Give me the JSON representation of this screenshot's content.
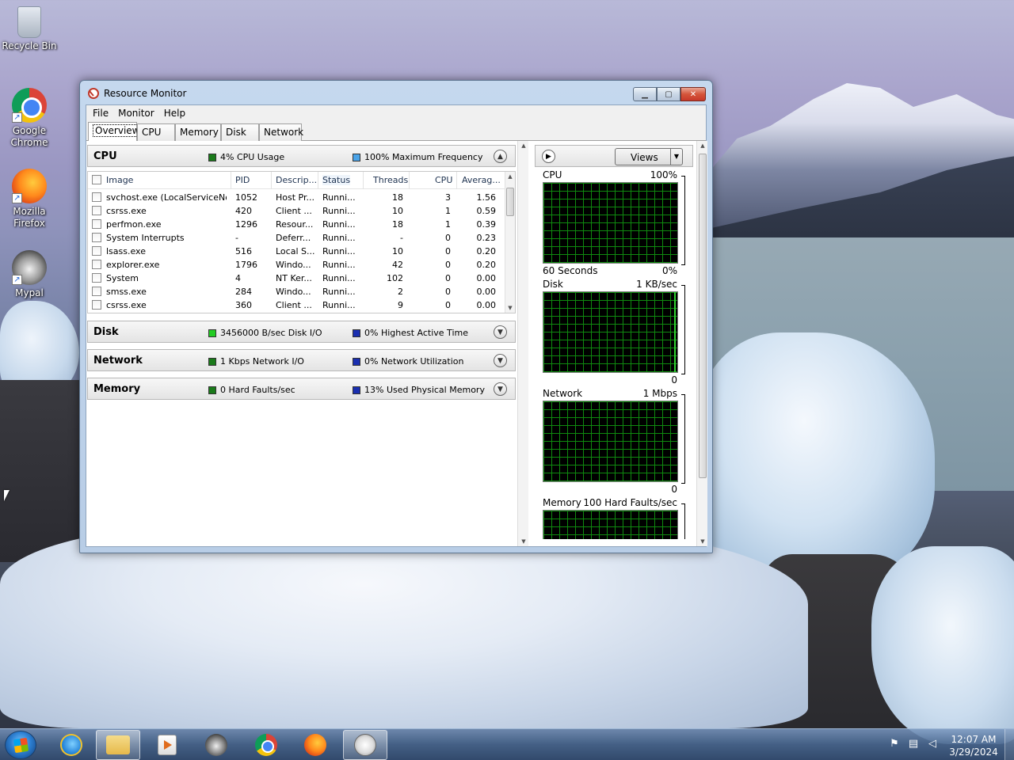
{
  "desktop": {
    "icons": [
      {
        "label": "Recycle Bin"
      },
      {
        "label": "Google\nChrome"
      },
      {
        "label": "Mozilla\nFirefox"
      },
      {
        "label": "Mypal"
      }
    ]
  },
  "window": {
    "title": "Resource Monitor",
    "menu": [
      "File",
      "Monitor",
      "Help"
    ],
    "tabs": [
      "Overview",
      "CPU",
      "Memory",
      "Disk",
      "Network"
    ],
    "active_tab": "Overview"
  },
  "cpu_section": {
    "title": "CPU",
    "legend1": "4% CPU Usage",
    "legend1_color": "#1a7a1a",
    "legend2": "100% Maximum Frequency",
    "legend2_color": "#4aa3e8",
    "columns": [
      "Image",
      "PID",
      "Descrip...",
      "Status",
      "Threads",
      "CPU",
      "Averag..."
    ],
    "rows": [
      {
        "image": "svchost.exe (LocalServiceNo...",
        "pid": "1052",
        "desc": "Host Pr...",
        "status": "Runni...",
        "threads": "18",
        "cpu": "3",
        "avg": "1.56"
      },
      {
        "image": "csrss.exe",
        "pid": "420",
        "desc": "Client ...",
        "status": "Runni...",
        "threads": "10",
        "cpu": "1",
        "avg": "0.59"
      },
      {
        "image": "perfmon.exe",
        "pid": "1296",
        "desc": "Resour...",
        "status": "Runni...",
        "threads": "18",
        "cpu": "1",
        "avg": "0.39"
      },
      {
        "image": "System Interrupts",
        "pid": "-",
        "desc": "Deferr...",
        "status": "Runni...",
        "threads": "-",
        "cpu": "0",
        "avg": "0.23"
      },
      {
        "image": "lsass.exe",
        "pid": "516",
        "desc": "Local S...",
        "status": "Runni...",
        "threads": "10",
        "cpu": "0",
        "avg": "0.20"
      },
      {
        "image": "explorer.exe",
        "pid": "1796",
        "desc": "Windo...",
        "status": "Runni...",
        "threads": "42",
        "cpu": "0",
        "avg": "0.20"
      },
      {
        "image": "System",
        "pid": "4",
        "desc": "NT Ker...",
        "status": "Runni...",
        "threads": "102",
        "cpu": "0",
        "avg": "0.00"
      },
      {
        "image": "smss.exe",
        "pid": "284",
        "desc": "Windo...",
        "status": "Runni...",
        "threads": "2",
        "cpu": "0",
        "avg": "0.00"
      },
      {
        "image": "csrss.exe",
        "pid": "360",
        "desc": "Client ...",
        "status": "Runni...",
        "threads": "9",
        "cpu": "0",
        "avg": "0.00"
      }
    ]
  },
  "disk_section": {
    "title": "Disk",
    "legend1": "3456000 B/sec Disk I/O",
    "legend1_color": "#22cc22",
    "legend2": "0% Highest Active Time",
    "legend2_color": "#1a2fb0"
  },
  "network_section": {
    "title": "Network",
    "legend1": "1 Kbps Network I/O",
    "legend1_color": "#1a7a1a",
    "legend2": "0% Network Utilization",
    "legend2_color": "#1a2fb0"
  },
  "memory_section": {
    "title": "Memory",
    "legend1": "0 Hard Faults/sec",
    "legend1_color": "#1a7a1a",
    "legend2": "13% Used Physical Memory",
    "legend2_color": "#1a2fb0"
  },
  "graphs": {
    "views_label": "Views",
    "cpu": {
      "name": "CPU",
      "max": "100%",
      "bottom_left": "60 Seconds",
      "bottom_right": "0%"
    },
    "disk": {
      "name": "Disk",
      "max": "1 KB/sec",
      "bottom_right": "0"
    },
    "network": {
      "name": "Network",
      "max": "1 Mbps",
      "bottom_right": "0"
    },
    "memory": {
      "name": "Memory",
      "max": "100 Hard Faults/sec"
    }
  },
  "taskbar": {
    "clock_time": "12:07 AM",
    "clock_date": "3/29/2024"
  }
}
